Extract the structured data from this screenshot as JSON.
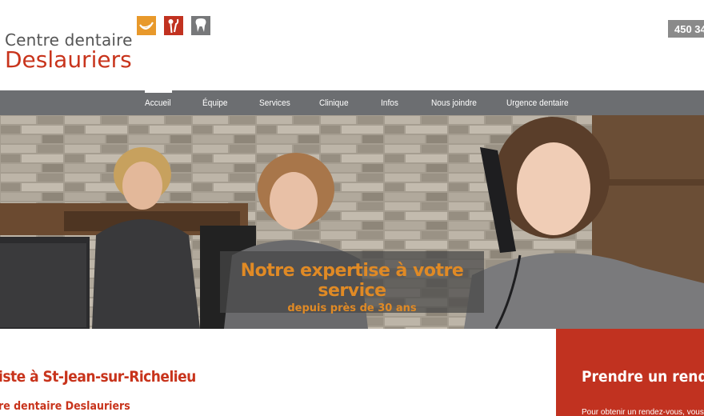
{
  "logo": {
    "line1": "Centre dentaire",
    "line2": "Deslauriers"
  },
  "header": {
    "phone": "450 34"
  },
  "nav": {
    "items": [
      {
        "label": "Accueil"
      },
      {
        "label": "Équipe"
      },
      {
        "label": "Services"
      },
      {
        "label": "Clinique"
      },
      {
        "label": "Infos"
      },
      {
        "label": "Nous joindre"
      },
      {
        "label": "Urgence dentaire"
      }
    ]
  },
  "hero": {
    "title": "Notre expertise à votre service",
    "subtitle": "depuis près de 30 ans"
  },
  "content": {
    "heading": "iste à St-Jean-sur-Richelieu",
    "subheading": "re dentaire Deslauriers"
  },
  "rdv": {
    "title": "Prendre un rendez-vou",
    "text": "Pour obtenir un rendez-vous, vous"
  },
  "colors": {
    "brand_red": "#c8341c",
    "nav_gray": "#6c6e71",
    "accent_orange": "#e08a25",
    "icon_orange": "#e8992b",
    "icon_red": "#c13220",
    "icon_gray": "#77787a"
  }
}
